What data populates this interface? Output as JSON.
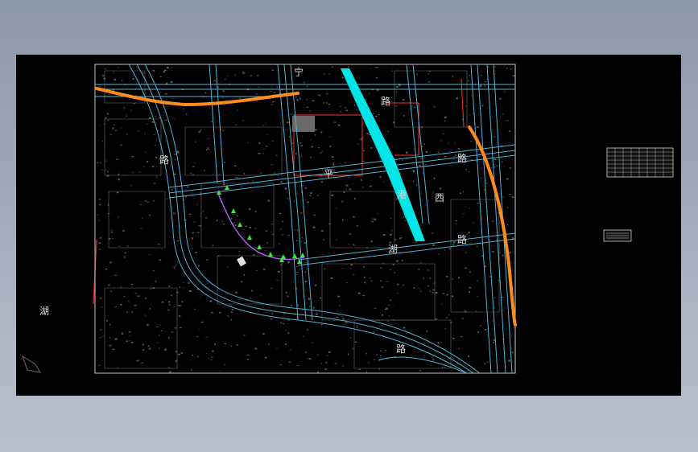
{
  "drawing": {
    "lake_label": "湖",
    "road_labels": [
      "宁",
      "路",
      "平",
      "港",
      "路",
      "西",
      "路",
      "湖",
      "路",
      "路"
    ],
    "colors": {
      "background": "#000000",
      "road_lines": "#4fb3d9",
      "grid_lines": "#8a8a8a",
      "highlight_route": "#ff8c1a",
      "channel": "#00e5e5",
      "block_outline": "#ff3030",
      "curve_markers": "#38e838",
      "curve_path": "#b060ff"
    },
    "legend_table_label": "",
    "legend_box_label": ""
  }
}
